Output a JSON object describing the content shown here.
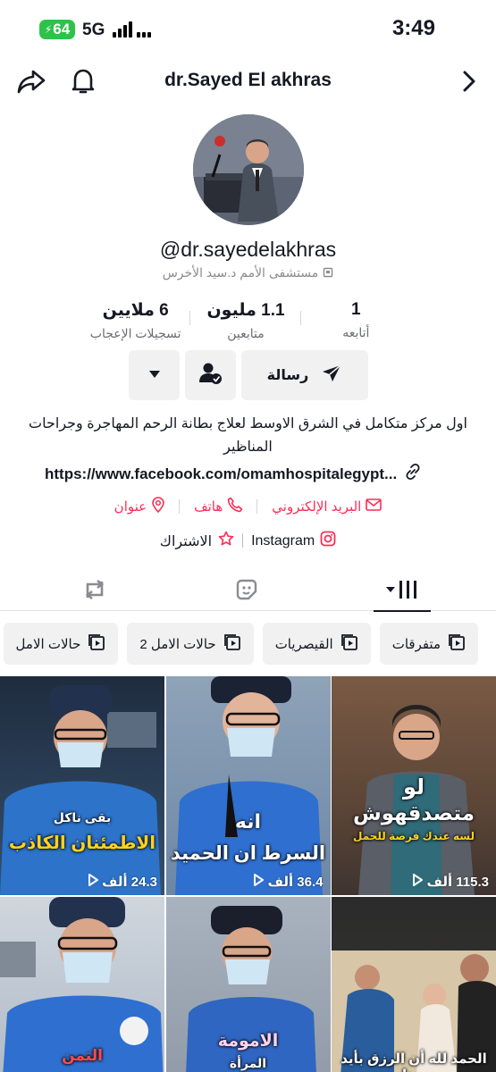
{
  "status_bar": {
    "battery": "64",
    "network": "5G",
    "time": "3:49"
  },
  "header": {
    "title": "dr.Sayed El akhras"
  },
  "icons": {
    "share": "share-icon",
    "bell": "bell-icon",
    "chevron": "chevron-right-icon"
  },
  "profile": {
    "handle": "@dr.sayedelakhras",
    "subname": "مستشفى الأمم د.سيد الأخرس",
    "stats": [
      {
        "value": "1",
        "label": "أتابعه"
      },
      {
        "value": "1.1 مليون",
        "label": "متابعين"
      },
      {
        "value": "6 ملايين",
        "label": "تسجيلات الإعجاب"
      }
    ],
    "message_label": "رسالة",
    "bio": "اول مركز متكامل في الشرق الاوسط لعلاج بطانة الرحم المهاجرة وجراحات المناظير",
    "link": "https://www.facebook.com/omamhospitalegypt...",
    "contacts": {
      "email": "البريد الإلكتروني",
      "phone": "هاتف",
      "address": "عنوان"
    },
    "socials": {
      "instagram": "Instagram",
      "subscribe": "الاشتراك"
    }
  },
  "playlists": [
    "متفرقات",
    "القيصريات",
    "حالات الامل 2",
    "حالات الامل"
  ],
  "videos": [
    {
      "views": "115.3 ألف",
      "caption_top": "لو",
      "caption_main": "متصدقهوش",
      "caption_sub": "لسه عندك فرصة للحمل"
    },
    {
      "views": "36.4 ألف",
      "caption_top": "انه",
      "caption_main": "السرط ان الحميد",
      "caption_sub": ""
    },
    {
      "views": "24.3 ألف",
      "caption_top": "بقى ناكل",
      "caption_main": "الاطمئنان الكاذب",
      "caption_sub": ""
    },
    {
      "views": "",
      "caption_top": "",
      "caption_main": "الحمد لله أن الرزق بأيد ربنا",
      "caption_sub": ""
    },
    {
      "views": "",
      "caption_top": "الامومة",
      "caption_main": "",
      "caption_sub": "المرأة"
    },
    {
      "views": "",
      "caption_top": "التمن",
      "caption_main": "",
      "caption_sub": ""
    }
  ],
  "colors": {
    "accent": "#fe2c55",
    "chip_bg": "#f1f1f2",
    "battery": "#2ec24a"
  }
}
